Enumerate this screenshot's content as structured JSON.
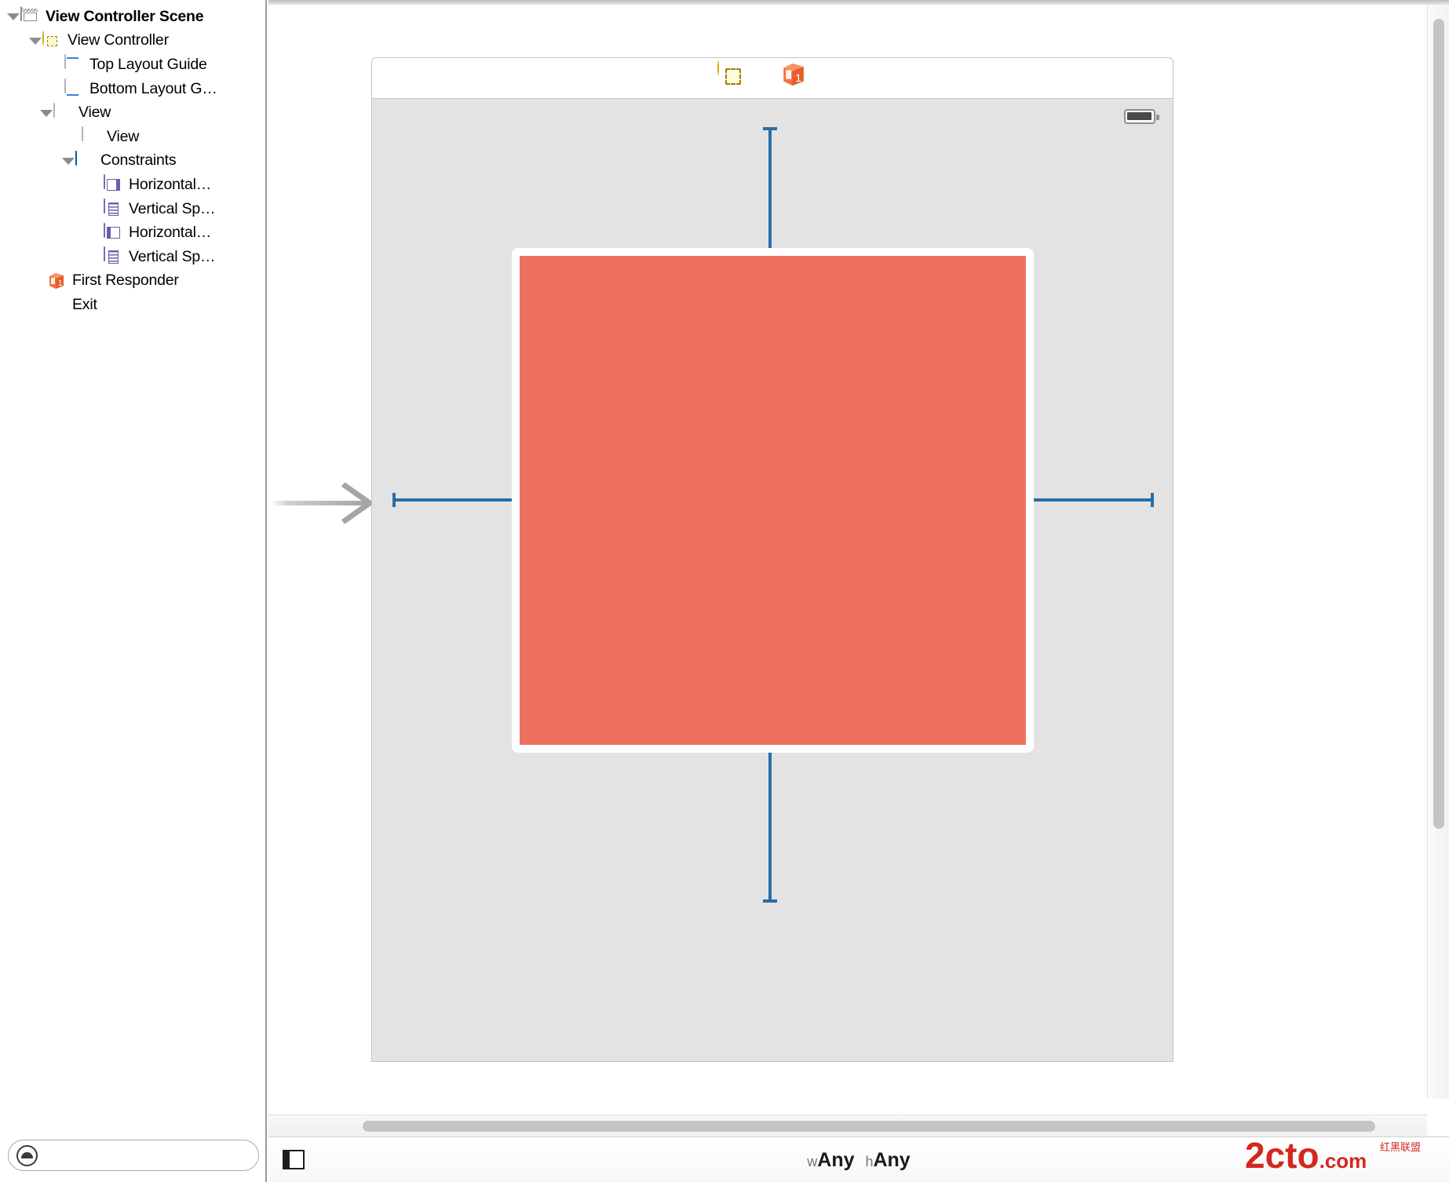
{
  "app": {
    "name": "Xcode Interface Builder",
    "accent_blue": "#2b6ca8",
    "selection_salmon": "#ee7160",
    "canvas_gray": "#e3e3e3"
  },
  "outline": {
    "title": "View Controller Scene",
    "filter_placeholder": "",
    "filter_value": "",
    "items": [
      {
        "label": "View Controller Scene",
        "icon": "scene-icon",
        "indent": 0,
        "expanded": true,
        "bold": true
      },
      {
        "label": "View Controller",
        "icon": "view-controller-icon",
        "indent": 1,
        "expanded": true,
        "bold": false
      },
      {
        "label": "Top Layout Guide",
        "icon": "top-layout-guide-icon",
        "indent": 2,
        "expanded": false,
        "bold": false
      },
      {
        "label": "Bottom Layout G…",
        "icon": "bottom-layout-guide-icon",
        "indent": 2,
        "expanded": false,
        "bold": false
      },
      {
        "label": "View",
        "icon": "view-icon",
        "indent": 2,
        "expanded": true,
        "bold": false
      },
      {
        "label": "View",
        "icon": "view-icon",
        "indent": 3,
        "expanded": false,
        "bold": false
      },
      {
        "label": "Constraints",
        "icon": "constraints-icon",
        "indent": 3,
        "expanded": true,
        "bold": false
      },
      {
        "label": "Horizontal…",
        "icon": "horizontal-space-constraint-icon",
        "indent": 4,
        "expanded": false,
        "bold": false
      },
      {
        "label": "Vertical Sp…",
        "icon": "vertical-space-constraint-icon",
        "indent": 4,
        "expanded": false,
        "bold": false
      },
      {
        "label": "Horizontal…",
        "icon": "horizontal-space-constraint-trailing-icon",
        "indent": 4,
        "expanded": false,
        "bold": false
      },
      {
        "label": "Vertical Sp…",
        "icon": "vertical-space-constraint-icon",
        "indent": 4,
        "expanded": false,
        "bold": false
      },
      {
        "label": "First Responder",
        "icon": "first-responder-icon",
        "indent": 1,
        "expanded": false,
        "bold": false
      },
      {
        "label": "Exit",
        "icon": "exit-icon",
        "indent": 1,
        "expanded": false,
        "bold": false
      }
    ]
  },
  "dock": {
    "icons": [
      {
        "name": "view-controller-dock-icon",
        "title": "View Controller"
      },
      {
        "name": "first-responder-dock-icon",
        "title": "First Responder"
      },
      {
        "name": "exit-dock-icon",
        "title": "Exit"
      }
    ]
  },
  "device": {
    "status_bar": {
      "battery": "battery-icon"
    },
    "subview": {
      "fill_color": "#ee7160",
      "selected": true
    }
  },
  "constraints_overlay": {
    "color": "#2b6ca8",
    "lines": [
      {
        "name": "top-vertical-space",
        "orientation": "vertical"
      },
      {
        "name": "bottom-vertical-space",
        "orientation": "vertical"
      },
      {
        "name": "leading-horizontal-space",
        "orientation": "horizontal"
      },
      {
        "name": "trailing-horizontal-space",
        "orientation": "horizontal"
      }
    ]
  },
  "statusbar": {
    "size_class": {
      "width_prefix": "w",
      "width_value": "Any",
      "height_prefix": "h",
      "height_value": "Any"
    },
    "tools": [
      {
        "name": "stack-view-button"
      },
      {
        "name": "align-button"
      },
      {
        "name": "pin-button"
      },
      {
        "name": "resolve-auto-layout-issues-button"
      }
    ],
    "utilities_toggle": "toggle-document-outline-button"
  },
  "watermark": {
    "text": "2cto.com",
    "sub_text": "红黑联盟",
    "color": "#d2291f"
  }
}
